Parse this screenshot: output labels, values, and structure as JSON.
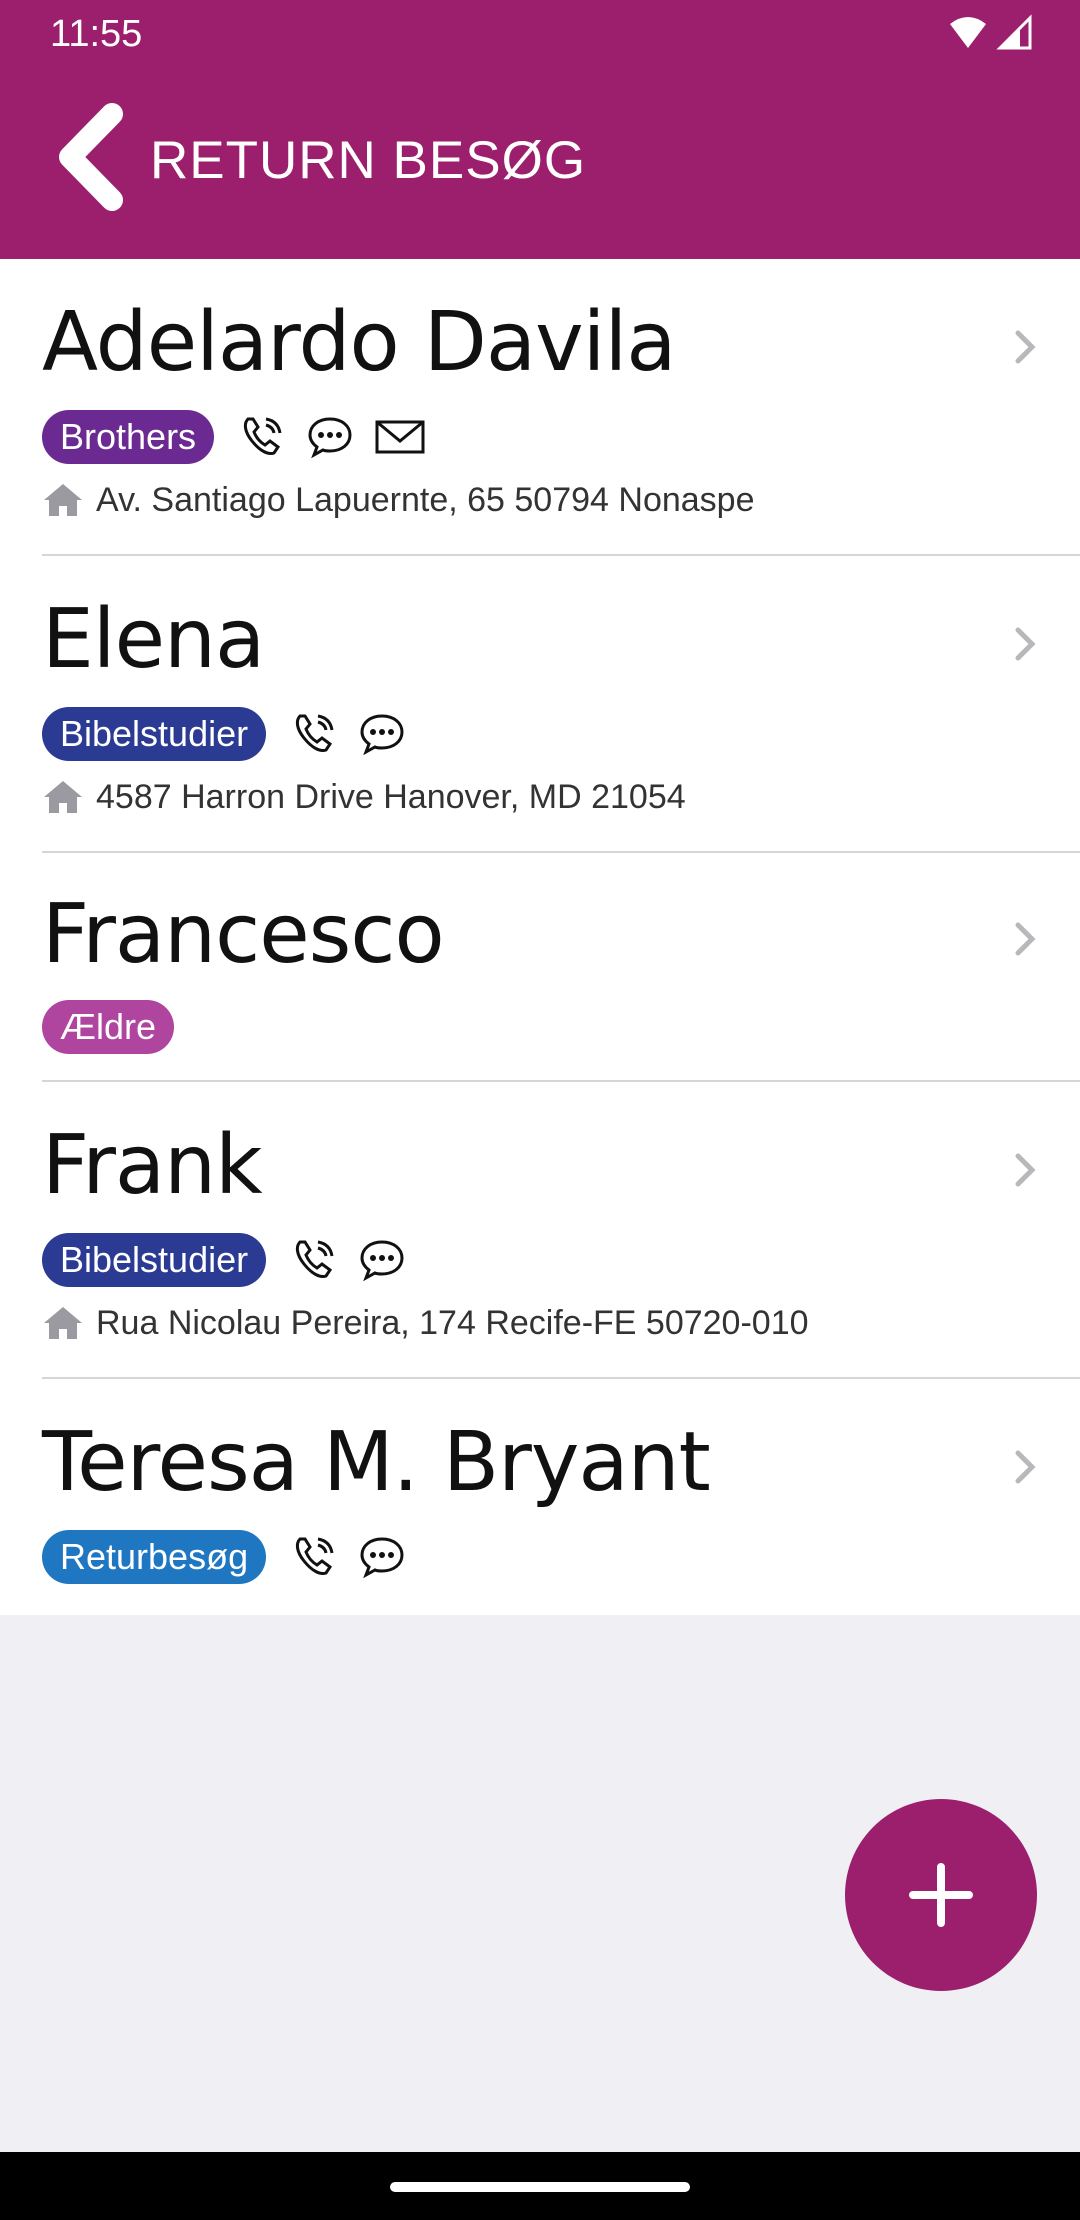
{
  "status_bar": {
    "time": "11:55"
  },
  "header": {
    "title": "RETURN BESØG"
  },
  "contacts": [
    {
      "name": "Adelardo Davila",
      "tag": "Brothers",
      "tag_color": "#6b2a92",
      "icons": [
        "phone-icon",
        "message-icon",
        "email-icon"
      ],
      "address": "Av. Santiago Lapuernte, 65 50794 Nonaspe"
    },
    {
      "name": "Elena",
      "tag": "Bibelstudier",
      "tag_color": "#2b3a93",
      "icons": [
        "phone-icon",
        "message-icon"
      ],
      "address": "4587 Harron Drive Hanover, MD 21054"
    },
    {
      "name": "Francesco",
      "tag": "Ældre",
      "tag_color": "#b0459f",
      "icons": [],
      "address": ""
    },
    {
      "name": "Frank",
      "tag": "Bibelstudier",
      "tag_color": "#2b3a93",
      "icons": [
        "phone-icon",
        "message-icon"
      ],
      "address": "Rua Nicolau Pereira, 174 Recife-FE 50720-010"
    },
    {
      "name": "Teresa M. Bryant",
      "tag": "Returbesøg",
      "tag_color": "#1f77c2",
      "icons": [
        "phone-icon",
        "message-icon"
      ],
      "address": ""
    }
  ],
  "colors": {
    "brand": "#9c1f6e",
    "background": "#efeff4"
  }
}
